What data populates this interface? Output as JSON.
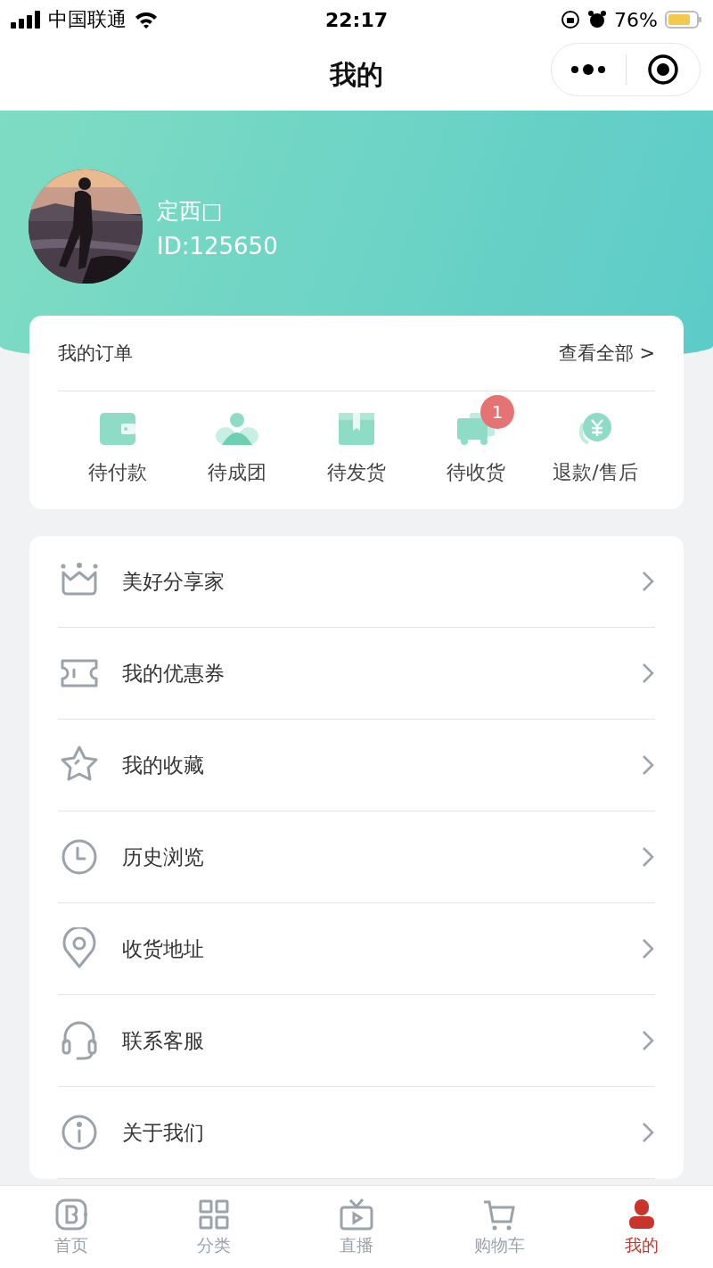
{
  "status_bar": {
    "carrier": "中国联通",
    "time": "22:17",
    "battery": "76%"
  },
  "nav": {
    "title": "我的"
  },
  "profile": {
    "name": "定西□",
    "id": "ID:125650"
  },
  "orders": {
    "title": "我的订单",
    "view_all": "查看全部 >",
    "items": [
      {
        "label": "待付款"
      },
      {
        "label": "待成团"
      },
      {
        "label": "待发货"
      },
      {
        "label": "待收货",
        "badge": "1"
      },
      {
        "label": "退款/售后"
      }
    ]
  },
  "menu": [
    {
      "label": "美好分享家"
    },
    {
      "label": "我的优惠券"
    },
    {
      "label": "我的收藏"
    },
    {
      "label": "历史浏览"
    },
    {
      "label": "收货地址"
    },
    {
      "label": "联系客服"
    },
    {
      "label": "关于我们"
    }
  ],
  "tab_bar": [
    {
      "label": "首页",
      "selected": false
    },
    {
      "label": "分类",
      "selected": false
    },
    {
      "label": "直播",
      "selected": false
    },
    {
      "label": "购物车",
      "selected": false
    },
    {
      "label": "我的",
      "selected": true
    }
  ]
}
